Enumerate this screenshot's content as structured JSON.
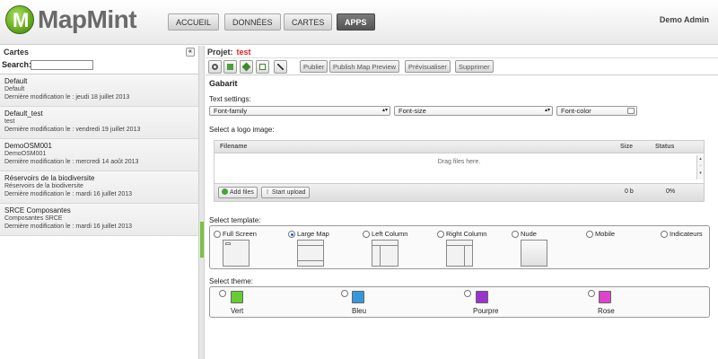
{
  "app": {
    "logo_letter": "M",
    "logo_name": "MapMint",
    "nav": [
      {
        "label": "ACCUEIL",
        "active": false
      },
      {
        "label": "DONNÉES",
        "active": false
      },
      {
        "label": "CARTES",
        "active": false
      },
      {
        "label": "APPS",
        "active": true
      }
    ],
    "user": "Demo Admin"
  },
  "sidebar": {
    "title": "Cartes",
    "collapse_glyph": "«",
    "search_label": "Search:",
    "search_value": "",
    "items": [
      {
        "name": "Default",
        "desc": "Default",
        "modified": "Dernière modification le : jeudi 18 juillet 2013"
      },
      {
        "name": "Default_test",
        "desc": "test",
        "modified": "Dernière modification le : vendredi 19 juillet 2013"
      },
      {
        "name": "DemoOSM001",
        "desc": "DemoOSM001",
        "modified": "Dernière modification le : mercredi 14 août 2013"
      },
      {
        "name": "Réservoirs de la biodiversite",
        "desc": "Réservoirs de la biodiversite",
        "modified": "Dernière modification le : mardi 16 juillet 2013"
      },
      {
        "name": "SRCE Composantes",
        "desc": "Composantes SRCE",
        "modified": "Dernière modification le : mardi 16 juillet 2013"
      }
    ]
  },
  "main": {
    "project_label": "Projet:",
    "project_name": "test",
    "toolbar_buttons": [
      "Publier",
      "Publish Map Preview",
      "Prévisualiser",
      "Supprimer"
    ],
    "section_title": "Gabarit",
    "text_settings_label": "Text settings:",
    "font_family": "Font-family",
    "font_size": "Font-size",
    "font_color": "Font-color",
    "logo_label": "Select a logo image:",
    "upload": {
      "col_filename": "Filename",
      "col_size": "Size",
      "col_status": "Status",
      "drop_text": "Drag files here.",
      "add_files": "Add files",
      "start_upload": "Start upload",
      "total_size": "0 b",
      "total_status": "0%"
    },
    "template_label": "Select template:",
    "templates": [
      {
        "label": "Full Screen",
        "selected": false
      },
      {
        "label": "Large Map",
        "selected": true
      },
      {
        "label": "Left Column",
        "selected": false
      },
      {
        "label": "Right Column",
        "selected": false
      },
      {
        "label": "Nude",
        "selected": false
      },
      {
        "label": "Mobile",
        "selected": false
      },
      {
        "label": "Indicateurs",
        "selected": false
      }
    ],
    "theme_label": "Select theme:",
    "themes": [
      {
        "label": "Vert",
        "color": "#66cc33"
      },
      {
        "label": "Bleu",
        "color": "#3399dd"
      },
      {
        "label": "Pourpre",
        "color": "#9933cc"
      },
      {
        "label": "Rose",
        "color": "#dd44cc"
      }
    ]
  }
}
